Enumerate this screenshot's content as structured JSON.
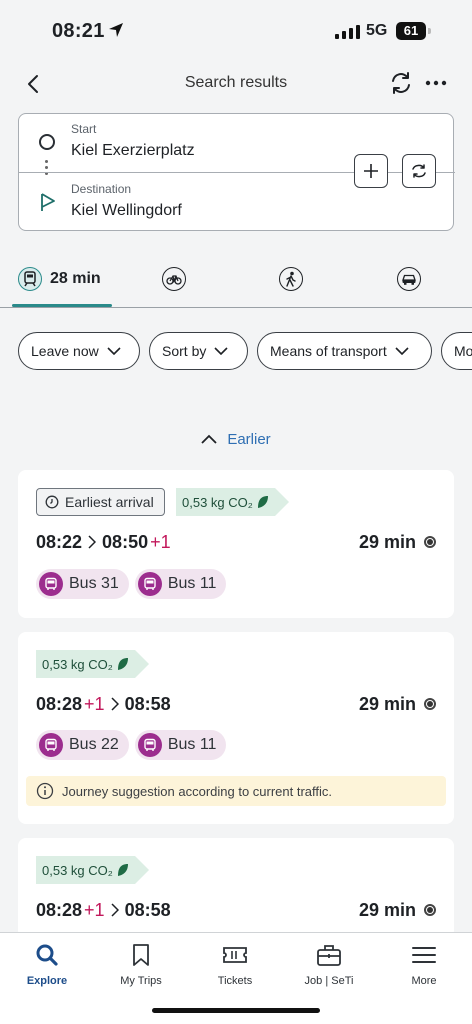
{
  "status_bar": {
    "time": "08:21",
    "network": "5G",
    "battery": "61"
  },
  "header": {
    "title": "Search results"
  },
  "route": {
    "start_label": "Start",
    "start_value": "Kiel Exerzierplatz",
    "destination_label": "Destination",
    "destination_value": "Kiel Wellingdorf"
  },
  "modes": {
    "active_duration": "28 min"
  },
  "filters": [
    "Leave now",
    "Sort by",
    "Means of transport",
    "Mo"
  ],
  "earlier_label": "Earlier",
  "journeys": [
    {
      "tag": "Earliest arrival",
      "co2": "0,53 kg CO₂",
      "depart": "08:22",
      "depart_delay": "",
      "arrive": "08:50",
      "arrive_delay": "+1",
      "duration": "29 min",
      "lines": [
        "Bus 31",
        "Bus 11"
      ]
    },
    {
      "co2": "0,53 kg CO₂",
      "depart": "08:28",
      "depart_delay": "+1",
      "arrive": "08:58",
      "duration": "29 min",
      "lines": [
        "Bus 22",
        "Bus 11"
      ],
      "info": "Journey suggestion according to current traffic."
    },
    {
      "co2": "0,53 kg CO₂",
      "depart": "08:28",
      "depart_delay": "+1",
      "arrive": "08:58",
      "duration": "29 min"
    }
  ],
  "tab_bar": [
    "Explore",
    "My Trips",
    "Tickets",
    "Job | SeTi",
    "More"
  ],
  "colors": {
    "accent": "#1d4d8a",
    "teal": "#2a8a8a",
    "bus": "#9c2d8e",
    "delay": "#c2185b"
  }
}
